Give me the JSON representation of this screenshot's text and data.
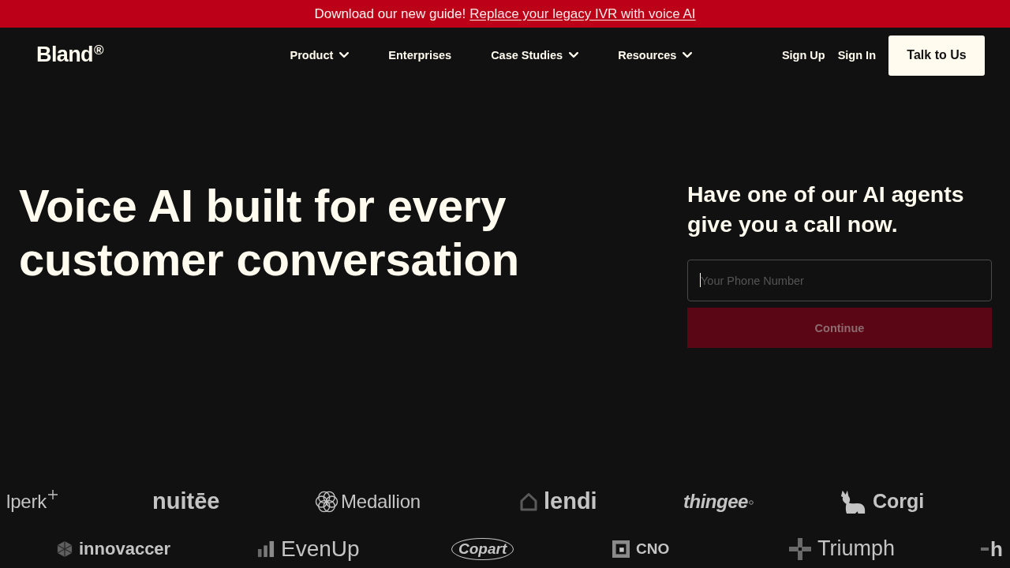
{
  "announcement": {
    "text": "Download our new guide!",
    "link": "Replace your legacy IVR with voice AI"
  },
  "nav": {
    "logo": "Bland$^{®}$",
    "items": [
      {
        "label": "Product",
        "has_menu": true
      },
      {
        "label": "Enterprises",
        "has_menu": false
      },
      {
        "label": "Case Studies",
        "has_menu": true
      },
      {
        "label": "Resources",
        "has_menu": true
      }
    ],
    "sign_up": "Sign Up",
    "sign_in": "Sign In",
    "cta": "Talk to Us"
  },
  "hero": {
    "headline": "Voice AI built for every customer conversation"
  },
  "call_form": {
    "title": "Have one of our AI agents give you a call now.",
    "phone_field": {
      "placeholder": "Your Phone Number",
      "focused": true
    },
    "submit": {
      "label": "Continue",
      "disabled": true
    }
  },
  "logo_rows": [
    {
      "logos": [
        "lperk",
        "nuitēe",
        "Medallion",
        "lendi",
        "thingee",
        "Corgi"
      ]
    },
    {
      "logos": [
        "innovaccer",
        "EvenUp",
        "Copart",
        "CNO",
        "Triumph",
        "h"
      ]
    }
  ]
}
